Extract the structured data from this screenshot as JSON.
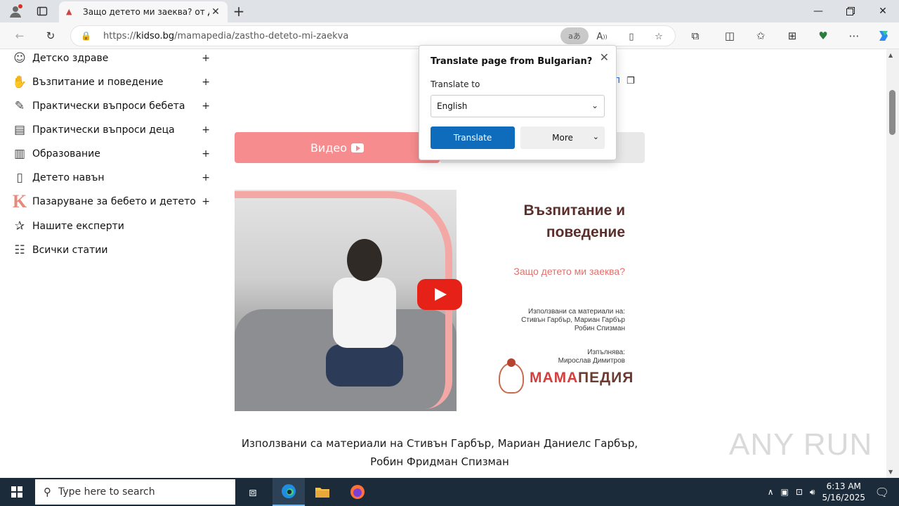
{
  "browser": {
    "tab_title": "Защо детето ми заеква? от Д-р",
    "tab_favicon": "favicon-icon",
    "url_prefix": "https://",
    "url_host": "kidso.bg",
    "url_path": "/mamapedia/zastho-deteto-mi-zaekva",
    "translate_glyph": "aあ"
  },
  "sidebar": {
    "items": [
      {
        "label": "Детско здраве",
        "icon": "baby-face-icon",
        "has_plus": true
      },
      {
        "label": "Възпитание и поведение",
        "icon": "hand-heart-icon",
        "has_plus": true
      },
      {
        "label": "Практически въпроси бебета",
        "icon": "notepad-pencil-icon",
        "has_plus": true
      },
      {
        "label": "Практически въпроси деца",
        "icon": "book-icon",
        "has_plus": true
      },
      {
        "label": "Образование",
        "icon": "open-book-icon",
        "has_plus": true
      },
      {
        "label": "Детето навън",
        "icon": "door-icon",
        "has_plus": true
      },
      {
        "label": "Пазаруване за бебето и детето",
        "icon": "k-logo-icon",
        "has_plus": true
      },
      {
        "label": "Нашите експерти",
        "icon": "star-icon",
        "has_plus": false
      },
      {
        "label": "Всички статии",
        "icon": "list-icon",
        "has_plus": false
      }
    ],
    "plus": "+"
  },
  "content": {
    "video_tab_label": "Видео",
    "video_card": {
      "title_line1": "Възпитание и",
      "title_line2": "поведение",
      "subtitle": "Защо детето ми заеква?",
      "credits_label": "Използвани са материали на:",
      "credits_line1": "Стивън Гарбър, Мариан Гарбър",
      "credits_line2": "Робин Спизман",
      "performer_label": "Изпълнява:",
      "performer_name": "Мирослав Димитров",
      "logo_part1": "МАМА",
      "logo_part2": "ПЕДИЯ"
    },
    "caption_line1": "Използвани са материали на Стивън Гарбър, Мариан Даниелс Гарбър,",
    "caption_line2": "Робин Фридман Спизман",
    "fragment_text": "п"
  },
  "translate_popup": {
    "title": "Translate page from Bulgarian?",
    "translate_to_label": "Translate to",
    "selected_language": "English",
    "translate_button": "Translate",
    "more_button": "More"
  },
  "taskbar": {
    "search_placeholder": "Type here to search",
    "time": "6:13 AM",
    "date": "5/16/2025"
  },
  "watermark": "ANY RUN",
  "colors": {
    "accent_blue": "#0f6cbd",
    "video_tab_pink": "#f68c8e",
    "youtube_red": "#e62117",
    "taskbar": "#1c2b3a"
  }
}
